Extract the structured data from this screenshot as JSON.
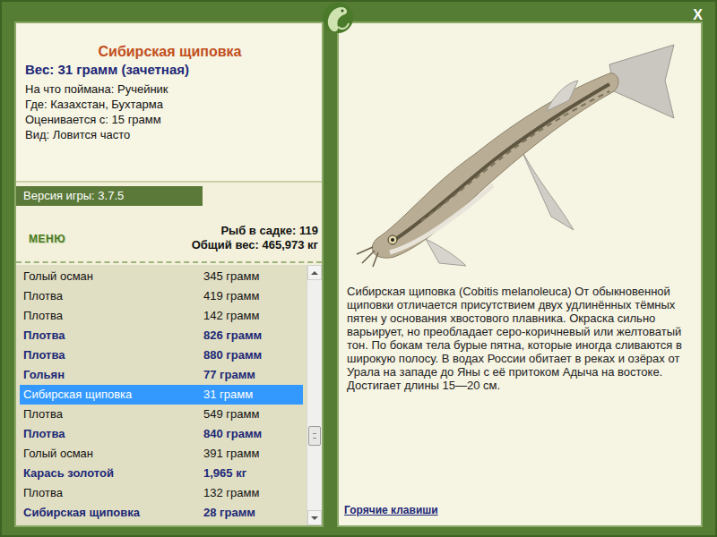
{
  "window": {
    "close": "X"
  },
  "fish": {
    "title": "Сибирская щиповка",
    "weight": "Вес: 31 грамм (зачетная)",
    "details": [
      "На что поймана: Ручейник",
      "Где: Казахстан, Бухтарма",
      "Оценивается с: 15 грамм",
      "Вид: Ловится часто"
    ]
  },
  "version": "Версия игры: 3.7.5",
  "menu": "МЕНЮ",
  "stats": [
    "Рыб в садке: 119",
    "Общий вес: 465,973 кг"
  ],
  "catch_list": {
    "scroll_level": 0.7,
    "rows": [
      {
        "name": "Голый осман",
        "weight": "345 грамм",
        "emphasized": false,
        "selected": false
      },
      {
        "name": "Плотва",
        "weight": "419 грамм",
        "emphasized": false,
        "selected": false
      },
      {
        "name": "Плотва",
        "weight": "142 грамм",
        "emphasized": false,
        "selected": false
      },
      {
        "name": "Плотва",
        "weight": "826 грамм",
        "emphasized": true,
        "selected": false
      },
      {
        "name": "Плотва",
        "weight": "880 грамм",
        "emphasized": true,
        "selected": false
      },
      {
        "name": "Гольян",
        "weight": "77 грамм",
        "emphasized": true,
        "selected": false
      },
      {
        "name": "Сибирская щиповка",
        "weight": "31 грамм",
        "emphasized": false,
        "selected": true
      },
      {
        "name": "Плотва",
        "weight": "549 грамм",
        "emphasized": false,
        "selected": false
      },
      {
        "name": "Плотва",
        "weight": "840 грамм",
        "emphasized": true,
        "selected": false
      },
      {
        "name": "Голый осман",
        "weight": "391 грамм",
        "emphasized": false,
        "selected": false
      },
      {
        "name": "Карась золотой",
        "weight": "1,965 кг",
        "emphasized": true,
        "selected": false
      },
      {
        "name": "Плотва",
        "weight": "132 грамм",
        "emphasized": false,
        "selected": false
      },
      {
        "name": "Сибирская щиповка",
        "weight": "28 грамм",
        "emphasized": true,
        "selected": false
      }
    ]
  },
  "description": "Сибирская щиповка (Cobitis melanoleuca) От обыкновенной щиповки отличается присутствием двух удлинённых тёмных пятен у основания хвостового плавника. Окраска сильно варьирует, но преобладает серо-коричневый или желтоватый тон. По бокам тела бурые пятна, которые иногда сливаются в широкую полосу. В водах России обитает в реках и озёрах от Урала на западе до Яны с её притоком Адыча на востоке. Достигает длины 15—20 см.",
  "hotkeys": "Горячие клавиши"
}
